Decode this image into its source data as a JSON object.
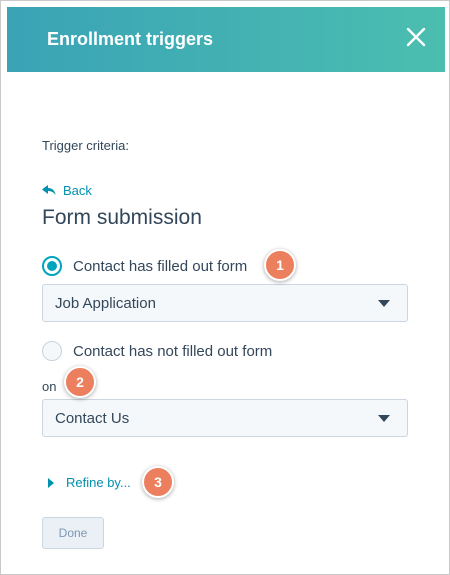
{
  "header": {
    "title": "Enrollment triggers",
    "background_colors": [
      "#3aa3b6",
      "#4bbeb0"
    ]
  },
  "icons": {
    "close": "close-icon",
    "back": "back-arrow-icon",
    "caret": "chevron-down-icon",
    "expand": "triangle-right-icon"
  },
  "form": {
    "criteria_label": "Trigger criteria:",
    "back_label": "Back",
    "section_title": "Form submission",
    "option_filled": {
      "label": "Contact has filled out form",
      "selected": true
    },
    "select_form": {
      "value": "Job Application"
    },
    "option_not_filled": {
      "label": "Contact has not filled out form",
      "selected": false
    },
    "on_label": "on",
    "select_page": {
      "value": "Contact Us"
    },
    "refine_label": "Refine by...",
    "done_label": "Done"
  },
  "callouts": {
    "one": "1",
    "two": "2",
    "three": "3",
    "color": "#ec7f5e"
  },
  "accent_color": "#00a4bd",
  "link_color": "#0091ae"
}
